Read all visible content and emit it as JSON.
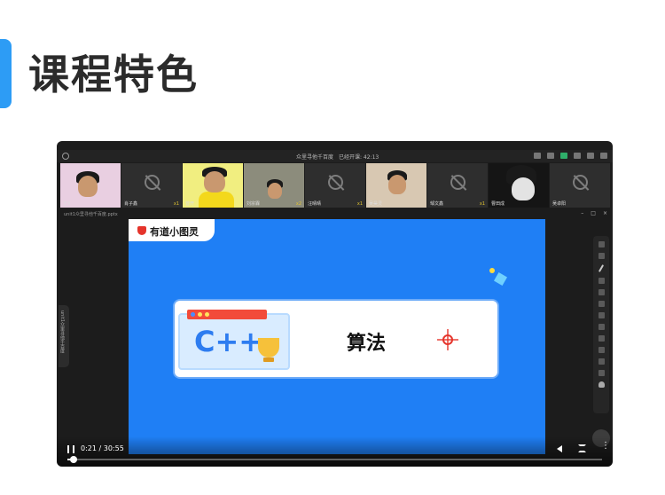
{
  "page": {
    "title": "课程特色"
  },
  "meeting": {
    "title": "众里寻他千百度",
    "timer": "已经开课: 42:13"
  },
  "participants": [
    {
      "name": "王X",
      "meta": ""
    },
    {
      "name": "肖子鑫",
      "meta": "x1"
    },
    {
      "name": "曾开",
      "meta": ""
    },
    {
      "name": "刘宗霖",
      "meta": "x2"
    },
    {
      "name": "汪晴晴",
      "meta": "x1"
    },
    {
      "name": "吴昊灵",
      "meta": ""
    },
    {
      "name": "邹文鑫",
      "meta": "x1"
    },
    {
      "name": "曹田成",
      "meta": ""
    },
    {
      "name": "吴卓阳",
      "meta": ""
    }
  ],
  "document": {
    "name": "unit1众里寻他千百度.pptx"
  },
  "slide": {
    "brand": "有道小图灵",
    "cpp": "C++",
    "title": "算法"
  },
  "side_panel": {
    "label": "unit1众里寻他千百度"
  },
  "player": {
    "time": "0:21 / 30:55",
    "progress": 0.011
  }
}
